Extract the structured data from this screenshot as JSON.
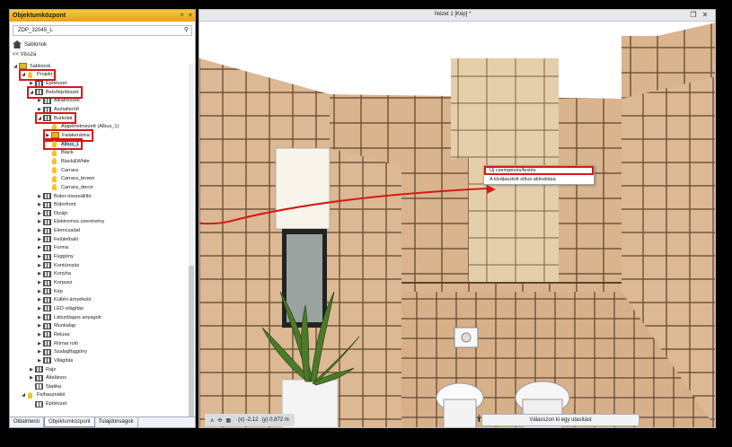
{
  "panel": {
    "title": "Objektumközpont",
    "pin_icon": "pin-icon",
    "close_icon": "close-icon",
    "search_value": "ZDP_32045_L",
    "breadcrumb": "Sablonok",
    "back_label": "<< Vissza"
  },
  "tree": [
    {
      "label": "Sablonok",
      "icon": "folder",
      "arrow": "◢",
      "indent": 0
    },
    {
      "label": "Projekt",
      "icon": "bulb",
      "arrow": "◢",
      "indent": 1,
      "selected": true
    },
    {
      "label": "Építészet",
      "icon": "grid",
      "arrow": "▶",
      "indent": 2
    },
    {
      "label": "Belsőépítészet",
      "icon": "grid",
      "arrow": "◢",
      "indent": 2,
      "selected": true
    },
    {
      "label": "Alkatrészek",
      "icon": "grid",
      "arrow": "▶",
      "indent": 3
    },
    {
      "label": "Asztalterítő",
      "icon": "grid",
      "arrow": "▶",
      "indent": 3
    },
    {
      "label": "Burkolat",
      "icon": "grid",
      "arrow": "◢",
      "indent": 3,
      "selected": true
    },
    {
      "label": "Alapértelmezett (Albus_1)",
      "icon": "bulb",
      "arrow": "",
      "indent": 4
    },
    {
      "label": "Falakerámia",
      "icon": "folder",
      "arrow": "▶",
      "indent": 4,
      "selected": true
    },
    {
      "label": "Albus_1",
      "icon": "bulb",
      "arrow": "",
      "indent": 4,
      "selected": true,
      "highlight": true
    },
    {
      "label": "Black",
      "icon": "bulb",
      "arrow": "",
      "indent": 4
    },
    {
      "label": "Black&White",
      "icon": "bulb",
      "arrow": "",
      "indent": 4
    },
    {
      "label": "Carrara",
      "icon": "bulb",
      "arrow": "",
      "indent": 4
    },
    {
      "label": "Carrara_brown",
      "icon": "bulb",
      "arrow": "",
      "indent": 4
    },
    {
      "label": "Carrara_decor",
      "icon": "bulb",
      "arrow": "",
      "indent": 4
    },
    {
      "label": "Bútor-összeállító",
      "icon": "grid",
      "arrow": "▶",
      "indent": 3
    },
    {
      "label": "Bútorfront",
      "icon": "grid",
      "arrow": "▶",
      "indent": 3
    },
    {
      "label": "Dizájn",
      "icon": "grid",
      "arrow": "▶",
      "indent": 3
    },
    {
      "label": "Elektromos szerelvény",
      "icon": "grid",
      "arrow": "▶",
      "indent": 3
    },
    {
      "label": "Elemcsalád",
      "icon": "grid",
      "arrow": "▶",
      "indent": 3
    },
    {
      "label": "Felülethaló",
      "icon": "grid",
      "arrow": "▶",
      "indent": 3
    },
    {
      "label": "Forma",
      "icon": "grid",
      "arrow": "▶",
      "indent": 3
    },
    {
      "label": "Függöny",
      "icon": "grid",
      "arrow": "▶",
      "indent": 3
    },
    {
      "label": "Kontúrozás",
      "icon": "grid",
      "arrow": "▶",
      "indent": 3
    },
    {
      "label": "Konyha",
      "icon": "grid",
      "arrow": "▶",
      "indent": 3
    },
    {
      "label": "Korpusz",
      "icon": "grid",
      "arrow": "▶",
      "indent": 3
    },
    {
      "label": "Kép",
      "icon": "grid",
      "arrow": "▶",
      "indent": 3
    },
    {
      "label": "Kültéri árnyékoló",
      "icon": "grid",
      "arrow": "▶",
      "indent": 3
    },
    {
      "label": "LED világítás",
      "icon": "grid",
      "arrow": "▶",
      "indent": 3
    },
    {
      "label": "Látszólagos anyagok",
      "icon": "grid",
      "arrow": "▶",
      "indent": 3
    },
    {
      "label": "Munkalap",
      "icon": "grid",
      "arrow": "▶",
      "indent": 3
    },
    {
      "label": "Reluxa",
      "icon": "grid",
      "arrow": "▶",
      "indent": 3
    },
    {
      "label": "Római roló",
      "icon": "grid",
      "arrow": "▶",
      "indent": 3
    },
    {
      "label": "Szalagfüggöny",
      "icon": "grid",
      "arrow": "▶",
      "indent": 3
    },
    {
      "label": "Világítás",
      "icon": "grid",
      "arrow": "▶",
      "indent": 3
    },
    {
      "label": "Rajz",
      "icon": "grid",
      "arrow": "▶",
      "indent": 2
    },
    {
      "label": "Általános",
      "icon": "grid",
      "arrow": "▶",
      "indent": 2
    },
    {
      "label": "Statika",
      "icon": "table",
      "arrow": "",
      "indent": 2
    },
    {
      "label": "Felhasználói",
      "icon": "bulb",
      "arrow": "◢",
      "indent": 1
    },
    {
      "label": "Építészet",
      "icon": "table",
      "arrow": "",
      "indent": 2
    }
  ],
  "tabs": [
    "Oldalmenü",
    "Objektumközpont",
    "Tulajdonságok"
  ],
  "view": {
    "title": "Nézet 1 [Kép] *",
    "context_menu": [
      "Új csempézés/festés",
      "A kiválasztott stílus aktiválása"
    ],
    "coord_x": "(x) -2.12",
    "coord_y": "(y) 0.872 m",
    "status_message": "Válasszon ki egy utasítást"
  },
  "colors": {
    "highlight_red": "#d91818",
    "panel_header": "#f0b429",
    "tile": "#dcb894"
  }
}
